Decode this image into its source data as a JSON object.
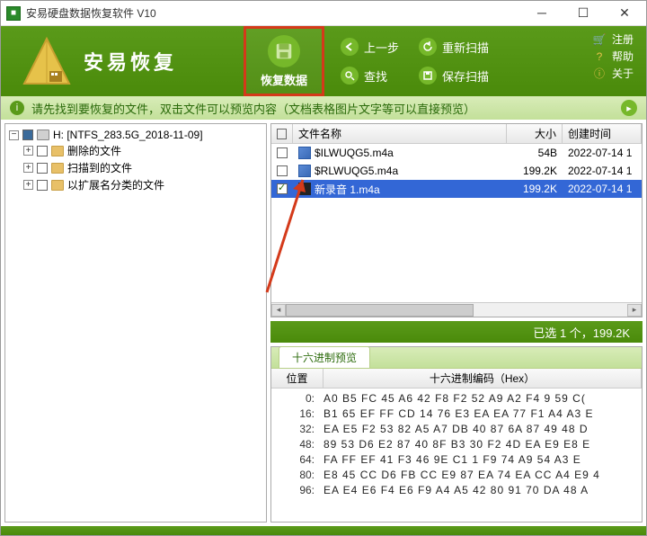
{
  "window": {
    "title": "安易硬盘数据恢复软件 V10"
  },
  "brand": "安易恢复",
  "main_action": "恢复数据",
  "toolbar": {
    "prev": "上一步",
    "rescan": "重新扫描",
    "search": "查找",
    "save_scan": "保存扫描"
  },
  "side": {
    "register": "注册",
    "help": "帮助",
    "about": "关于"
  },
  "tip": "请先找到要恢复的文件，双击文件可以预览内容（文档表格图片文字等可以直接预览）",
  "tree": {
    "root": "H: [NTFS_283.5G_2018-11-09]",
    "items": [
      "删除的文件",
      "扫描到的文件",
      "以扩展名分类的文件"
    ]
  },
  "list": {
    "headers": {
      "name": "文件名称",
      "size": "大小",
      "date": "创建时间"
    },
    "rows": [
      {
        "checked": false,
        "icon": "m4a",
        "name": "$ILWUQG5.m4a",
        "size": "54B",
        "date": "2022-07-14 1",
        "sel": false
      },
      {
        "checked": false,
        "icon": "m4a",
        "name": "$RLWUQG5.m4a",
        "size": "199.2K",
        "date": "2022-07-14 1",
        "sel": false
      },
      {
        "checked": true,
        "icon": "blk",
        "name": "新录音 1.m4a",
        "size": "199.2K",
        "date": "2022-07-14 1",
        "sel": true
      }
    ]
  },
  "status": "已选 1 个，199.2K",
  "hex": {
    "tab": "十六进制预览",
    "headers": {
      "offset": "位置",
      "hex": "十六进制编码（Hex）"
    },
    "rows": [
      {
        "off": "0:",
        "b": "A0  B5  FC  45  A6  42  F8  F2    52  A9  A2  F4  9  59  C("
      },
      {
        "off": "16:",
        "b": "B1  65  EF  FF  CD  14  76  E3    EA  EA  77  F1  A4  A3  E"
      },
      {
        "off": "32:",
        "b": "EA  E5  F2  53  82  A5  A7  DB    40  87  6A  87  49  48  D"
      },
      {
        "off": "48:",
        "b": "89  53  D6  E2  87  40  8F  B3    30  F2  4D  EA  E9  E8  E"
      },
      {
        "off": "64:",
        "b": "FA  FF  EF  41  F3  46  9E  C1    1  F9  74  A9  54  A3  E"
      },
      {
        "off": "80:",
        "b": "E8  45  CC  D6  FB  CC  E9  87    EA  74  EA  CC  A4  E9  4"
      },
      {
        "off": "96:",
        "b": "EA  E4  E6  F4  E6  F9  A4  A5    42  80  91  70  DA  48  A"
      }
    ]
  }
}
